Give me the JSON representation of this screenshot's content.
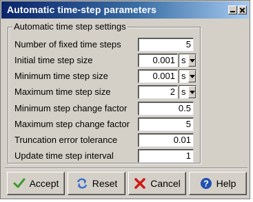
{
  "window": {
    "title": "Automatic time-step parameters",
    "minimize_icon": "minimize-icon",
    "close_icon": "close-icon"
  },
  "group": {
    "legend": "Automatic time step settings"
  },
  "fields": [
    {
      "label": "Number of fixed time steps",
      "value": "5"
    },
    {
      "label": "Initial time step size",
      "value": "0.001",
      "unit": "s"
    },
    {
      "label": "Minimum time step size",
      "value": "0.001",
      "unit": "s"
    },
    {
      "label": "Maximum time step size",
      "value": "2",
      "unit": "s"
    },
    {
      "label": "Minimum step change factor",
      "value": "0.5"
    },
    {
      "label": "Maximum step change factor",
      "value": "5"
    },
    {
      "label": "Truncation error tolerance",
      "value": "0.01"
    },
    {
      "label": "Update time step interval",
      "value": "1"
    }
  ],
  "buttons": {
    "accept": {
      "label": "Accept",
      "icon": "checkmark-icon",
      "color": "#3a9a2a"
    },
    "reset": {
      "label": "Reset",
      "icon": "refresh-icon",
      "color": "#3a6fd0"
    },
    "cancel": {
      "label": "Cancel",
      "icon": "x-icon",
      "color": "#d01818"
    },
    "help": {
      "label": "Help",
      "icon": "question-icon",
      "color": "#2050b0"
    }
  }
}
